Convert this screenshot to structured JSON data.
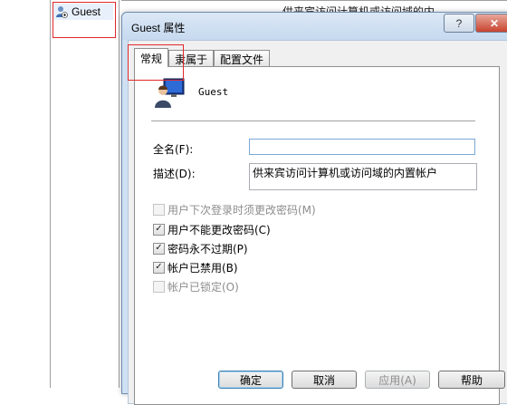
{
  "background": {
    "user_list": [
      {
        "label": "Guest",
        "icon": "user-icon"
      }
    ],
    "description_partial": "供来宾访问计算机或访问域的内"
  },
  "dialog": {
    "title": "Guest 属性",
    "title_buttons": {
      "help": "?",
      "close": "✕"
    },
    "tabs": [
      {
        "label": "常规",
        "active": true
      },
      {
        "label": "隶属于",
        "active": false
      },
      {
        "label": "配置文件",
        "active": false
      }
    ],
    "general": {
      "username": "Guest",
      "fullname_label": "全名(F):",
      "fullname_value": "",
      "description_label": "描述(D):",
      "description_value": "供来宾访问计算机或访问域的内置帐户",
      "checkboxes": [
        {
          "label": "用户下次登录时须更改密码(M)",
          "checked": false,
          "disabled": true
        },
        {
          "label": "用户不能更改密码(C)",
          "checked": true,
          "disabled": false
        },
        {
          "label": "密码永不过期(P)",
          "checked": true,
          "disabled": false
        },
        {
          "label": "帐户已禁用(B)",
          "checked": true,
          "disabled": false
        },
        {
          "label": "帐户已锁定(O)",
          "checked": false,
          "disabled": true
        }
      ]
    },
    "buttons": {
      "ok": "确定",
      "cancel": "取消",
      "apply": "应用(A)",
      "help": "帮助"
    }
  },
  "colors": {
    "highlight_box": "#e0282a",
    "dialog_frame": "#cfe0f2"
  }
}
